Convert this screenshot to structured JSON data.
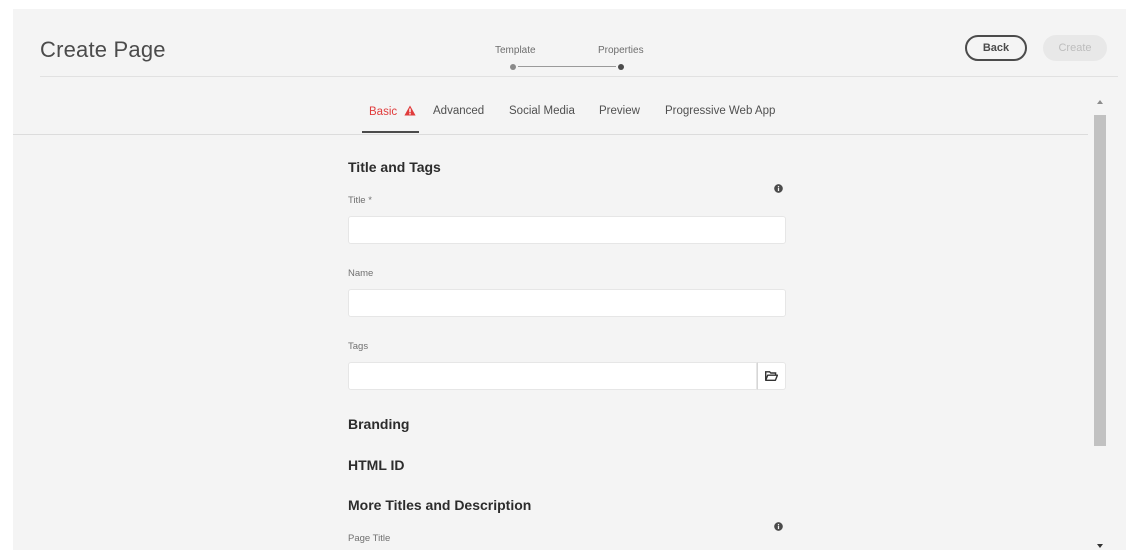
{
  "header": {
    "title": "Create Page",
    "steps": [
      {
        "label": "Template",
        "state": "completed"
      },
      {
        "label": "Properties",
        "state": "current"
      }
    ],
    "back_label": "Back",
    "create_label": "Create"
  },
  "tabs": [
    {
      "label": "Basic",
      "active": true,
      "has_warning": true
    },
    {
      "label": "Advanced"
    },
    {
      "label": "Social Media"
    },
    {
      "label": "Preview"
    },
    {
      "label": "Progressive Web App"
    }
  ],
  "form": {
    "title_and_tags": "Title and Tags",
    "title_label": "Title *",
    "title_value": "",
    "name_label": "Name",
    "name_value": "",
    "tags_label": "Tags",
    "tags_value": "",
    "branding": "Branding",
    "html_id": "HTML ID",
    "more_titles": "More Titles and Description",
    "page_title_label": "Page Title"
  },
  "icons": {
    "warning": "warning-triangle-icon",
    "info": "info-icon",
    "folder": "folder-open-icon"
  },
  "colors": {
    "warning": "#e03c3c",
    "background": "#f4f4f4",
    "text": "#4b4b4b"
  }
}
